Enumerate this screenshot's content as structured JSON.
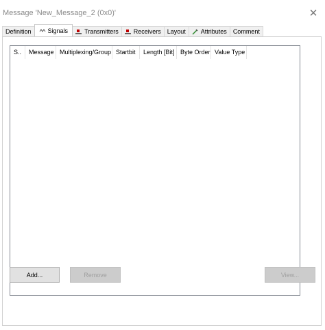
{
  "window": {
    "title": "Message 'New_Message_2 (0x0)'",
    "close_icon": "close-icon"
  },
  "tabs": [
    {
      "label": "Definition",
      "icon": null,
      "active": false
    },
    {
      "label": "Signals",
      "icon": "signals-icon",
      "active": true
    },
    {
      "label": "Transmitters",
      "icon": "transmitter-icon",
      "active": false
    },
    {
      "label": "Receivers",
      "icon": "receiver-icon",
      "active": false
    },
    {
      "label": "Layout",
      "icon": null,
      "active": false
    },
    {
      "label": "Attributes",
      "icon": "attributes-icon",
      "active": false
    },
    {
      "label": "Comment",
      "icon": null,
      "active": false
    }
  ],
  "list": {
    "columns": [
      "S..",
      "Message",
      "Multiplexing/Group",
      "Startbit",
      "Length [Bit]",
      "Byte Order",
      "Value Type"
    ],
    "rows": []
  },
  "buttons": {
    "add": "Add...",
    "remove": "Remove",
    "view": "View..."
  },
  "colors": {
    "accent_red": "#c00000",
    "button_face": "#e1e1e1",
    "disabled_text": "#a0a0a0"
  }
}
